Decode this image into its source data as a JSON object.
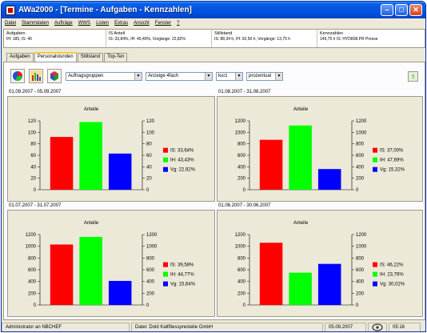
{
  "window": {
    "title": "AWa2000 - [Termine - Aufgaben - Kennzahlen]"
  },
  "menu": [
    "Datei",
    "Stammdaten",
    "Aufträge",
    "WWS",
    "Listen",
    "Extras",
    "Ansicht",
    "Fenster",
    "?"
  ],
  "info": {
    "aufgaben": {
      "head": "Aufgaben",
      "value": "IH: 185, IS: 40"
    },
    "is_anteil": {
      "head": "IS Anteil",
      "value": "IS: 33,84%, IH: 40,40%, Vorgänge: 22,82%"
    },
    "stillstand": {
      "head": "Stillstand",
      "value": "IS: 88,34 h, IH: 92,50 h, Vorgänge: 13,75 h"
    },
    "kennzahlen": {
      "head": "Kennzahlen",
      "value": "149,75 h IS: HYD808.PR Presse"
    }
  },
  "tabs": [
    "Aufgaben",
    "Personalstunden",
    "Stillstand",
    "Top-Ten"
  ],
  "active_tab": "Personalstunden",
  "toolbar": {
    "group_select": "Auftragsgruppen",
    "view_select": "Anzeige 4fach",
    "length_select": "kurz",
    "mode_select": "prozentual"
  },
  "colors": {
    "is": "#ff0000",
    "ih": "#00ff00",
    "vg": "#0000ff"
  },
  "chart_data": [
    {
      "type": "bar",
      "period": "01.09.2007 - 05.09.2007",
      "title": "Anteile",
      "ylim": [
        0,
        120
      ],
      "yticks": [
        0,
        20,
        40,
        60,
        80,
        100,
        120
      ],
      "series": [
        {
          "name": "IS",
          "label": "IS: 33,64%",
          "value": 92
        },
        {
          "name": "IH",
          "label": "IH: 43,43%",
          "value": 118
        },
        {
          "name": "Vg",
          "label": "Vg: 22,92%",
          "value": 63
        }
      ]
    },
    {
      "type": "bar",
      "period": "01.08.2007 - 31.08.2007",
      "title": "Anteile",
      "ylim": [
        0,
        1200
      ],
      "yticks": [
        0,
        200,
        400,
        600,
        800,
        1000,
        1200
      ],
      "series": [
        {
          "name": "IS",
          "label": "IS: 37,00%",
          "value": 870
        },
        {
          "name": "IH",
          "label": "IH: 47,69%",
          "value": 1120
        },
        {
          "name": "Vg",
          "label": "Vg: 15,32%",
          "value": 360
        }
      ]
    },
    {
      "type": "bar",
      "period": "01.07.2007 - 31.07.2007",
      "title": "Anteile",
      "ylim": [
        0,
        1200
      ],
      "yticks": [
        0,
        200,
        400,
        600,
        800,
        1000,
        1200
      ],
      "series": [
        {
          "name": "IS",
          "label": "IS: 39,58%",
          "value": 1030
        },
        {
          "name": "IH",
          "label": "IH: 44,77%",
          "value": 1160
        },
        {
          "name": "Vg",
          "label": "Vg: 15,64%",
          "value": 410
        }
      ]
    },
    {
      "type": "bar",
      "period": "01.06.2007 - 30.06.2007",
      "title": "Anteile",
      "ylim": [
        0,
        1200
      ],
      "yticks": [
        0,
        200,
        400,
        600,
        800,
        1000,
        1200
      ],
      "series": [
        {
          "name": "IS",
          "label": "IS: 46,22%",
          "value": 1060
        },
        {
          "name": "IH",
          "label": "IH: 23,76%",
          "value": 550
        },
        {
          "name": "Vg",
          "label": "Vg: 30,02%",
          "value": 700
        }
      ]
    }
  ],
  "status": {
    "user": "Administrator an NBCHEF",
    "database": "Datei: Dold Kaltfliesspresteile GmbH",
    "date": "05.09.2007",
    "time": "05:16"
  }
}
